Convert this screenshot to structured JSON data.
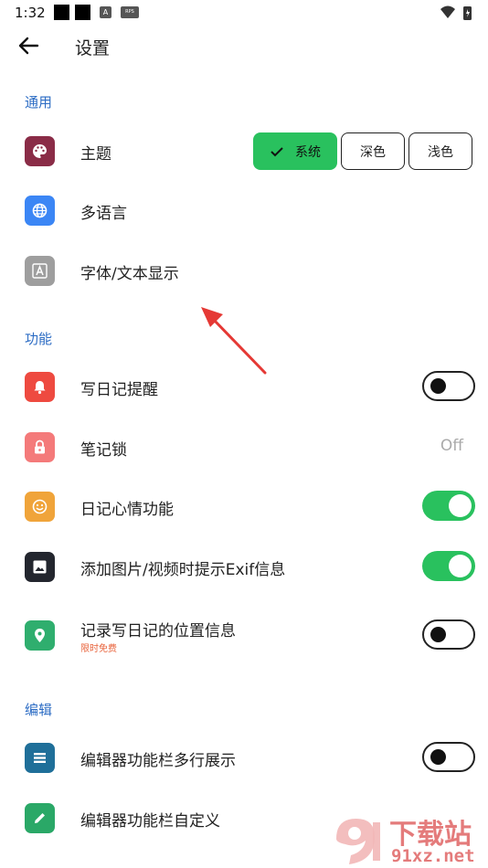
{
  "status_bar": {
    "time": "1:32",
    "badge_a": "A",
    "badge_rps": "RPS"
  },
  "app_bar": {
    "title": "设置"
  },
  "sections": {
    "general": "通用",
    "features": "功能",
    "editing": "编辑"
  },
  "theme": {
    "label": "主题",
    "options": [
      "系统",
      "深色",
      "浅色"
    ],
    "selected": "系统"
  },
  "general_items": {
    "language": "多语言",
    "font": "字体/文本显示"
  },
  "feature_items": {
    "reminder": {
      "label": "写日记提醒",
      "enabled": false
    },
    "lock": {
      "label": "笔记锁",
      "value": "Off"
    },
    "mood": {
      "label": "日记心情功能",
      "enabled": true
    },
    "exif": {
      "label": "添加图片/视频时提示Exif信息",
      "enabled": true
    },
    "location": {
      "label": "记录写日记的位置信息",
      "tag": "限时免费",
      "enabled": false
    }
  },
  "edit_items": {
    "multiline": {
      "label": "编辑器功能栏多行展示",
      "enabled": false
    },
    "custom": {
      "label": "编辑器功能栏自定义"
    }
  },
  "watermark": {
    "brand": "下载站",
    "site": "91xz.net"
  },
  "colors": {
    "accent": "#2c6cc4",
    "toggle_on": "#29c15e",
    "icon_theme": "#8a2c47",
    "icon_language": "#3b86f5",
    "icon_font": "#9e9e9e",
    "icon_reminder": "#ee4a40",
    "icon_lock": "#f47a7a",
    "icon_mood": "#f0a43a",
    "icon_exif": "#23262e",
    "icon_location": "#2fae6e",
    "icon_multiline": "#1f6f99",
    "icon_custom": "#2aa867",
    "annotation_arrow": "#e53935"
  },
  "icons": [
    "palette-icon",
    "globe-icon",
    "font-icon",
    "bell-icon",
    "lock-icon",
    "smile-icon",
    "image-icon",
    "location-pin-icon",
    "list-icon",
    "pencil-icon"
  ]
}
